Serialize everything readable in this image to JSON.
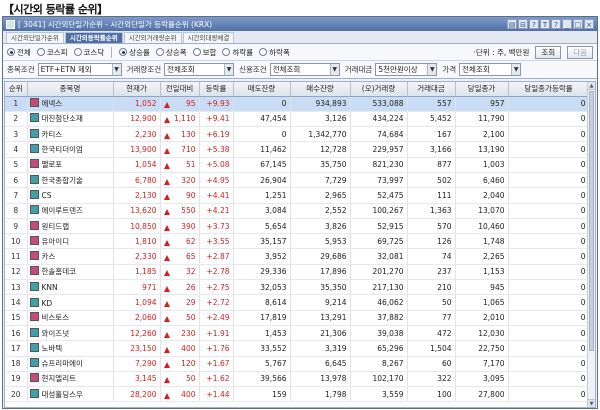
{
  "heading": "【시간외 등락률 순위】",
  "window": {
    "title": "[ 3041] 시간외단일가순위 - 시간외단일가 등락률순위 (KRX)",
    "controls": [
      "▤",
      "⊟",
      "?",
      "T",
      "?",
      "_",
      "□",
      "×"
    ]
  },
  "tabs": [
    "시간외단일가순위",
    "시간외등락률순위",
    "시간외거래량순위",
    "시간외대량체결"
  ],
  "active_tab": 1,
  "market_radios": [
    {
      "label": "전체",
      "on": true
    },
    {
      "label": "코스피",
      "on": false
    },
    {
      "label": "코스닥",
      "on": false
    }
  ],
  "change_radios": [
    {
      "label": "상승률",
      "on": true
    },
    {
      "label": "상승폭",
      "on": false
    },
    {
      "label": "보합",
      "on": false
    },
    {
      "label": "하락률",
      "on": false
    },
    {
      "label": "하락폭",
      "on": false
    }
  ],
  "unit_text": "·단위 : 주, 백만원",
  "buttons": {
    "query": "조회",
    "next": "다음"
  },
  "filters": [
    {
      "label": "종목조건",
      "value": "ETF+ETN 제외"
    },
    {
      "label": "거래량조건",
      "value": "전체조회"
    },
    {
      "label": "신용조건",
      "value": "전체조회"
    },
    {
      "label": "거래대금",
      "value": "5천만원이상"
    },
    {
      "label": "가격",
      "value": "전체조회"
    }
  ],
  "columns": [
    "순위",
    "종목명",
    "현재가",
    "전일대비",
    "등락률",
    "매도잔량",
    "매수잔량",
    "(오)거래량",
    "거래대금",
    "당일종가",
    "당일종가등락률"
  ],
  "rows": [
    {
      "rank": "1",
      "market": "P",
      "name": "에넥스",
      "price": "1,052",
      "change": "95",
      "rate": "+9.93",
      "ask": "0",
      "bid": "934,893",
      "volume": "533,088",
      "amount": "557",
      "close": "957",
      "close_rate": "0"
    },
    {
      "rank": "2",
      "market": "K",
      "name": "대진첨단소재",
      "price": "12,900",
      "change": "1,110",
      "rate": "+9.41",
      "ask": "47,454",
      "bid": "3,126",
      "volume": "434,224",
      "amount": "5,452",
      "close": "11,790",
      "close_rate": "0"
    },
    {
      "rank": "3",
      "market": "K",
      "name": "카티스",
      "price": "2,230",
      "change": "130",
      "rate": "+6.19",
      "ask": "0",
      "bid": "1,342,770",
      "volume": "74,684",
      "amount": "167",
      "close": "2,100",
      "close_rate": "0"
    },
    {
      "rank": "4",
      "market": "K",
      "name": "한국티더이엄",
      "price": "13,900",
      "change": "710",
      "rate": "+5.38",
      "ask": "11,462",
      "bid": "12,728",
      "volume": "229,957",
      "amount": "3,166",
      "close": "13,190",
      "close_rate": "0"
    },
    {
      "rank": "5",
      "market": "P",
      "name": "팰로포",
      "price": "1,054",
      "change": "51",
      "rate": "+5.08",
      "ask": "67,145",
      "bid": "35,750",
      "volume": "821,230",
      "amount": "877",
      "close": "1,003",
      "close_rate": "0"
    },
    {
      "rank": "6",
      "market": "K",
      "name": "한국종합기술",
      "price": "6,780",
      "change": "320",
      "rate": "+4.95",
      "ask": "26,904",
      "bid": "7,729",
      "volume": "73,997",
      "amount": "502",
      "close": "6,460",
      "close_rate": "0"
    },
    {
      "rank": "7",
      "market": "K",
      "name": "CS",
      "price": "2,130",
      "change": "90",
      "rate": "+4.41",
      "ask": "1,251",
      "bid": "2,965",
      "volume": "52,475",
      "amount": "111",
      "close": "2,040",
      "close_rate": "0"
    },
    {
      "rank": "8",
      "market": "K",
      "name": "에이루트덴즈",
      "price": "13,620",
      "change": "550",
      "rate": "+4.21",
      "ask": "3,084",
      "bid": "2,552",
      "volume": "100,267",
      "amount": "1,363",
      "close": "13,070",
      "close_rate": "0"
    },
    {
      "rank": "9",
      "market": "P",
      "name": "원티드랩",
      "price": "10,850",
      "change": "390",
      "rate": "+3.73",
      "ask": "5,654",
      "bid": "3,826",
      "volume": "52,915",
      "amount": "570",
      "close": "10,460",
      "close_rate": "0"
    },
    {
      "rank": "10",
      "market": "P",
      "name": "유아이디",
      "price": "1,810",
      "change": "62",
      "rate": "+3.55",
      "ask": "35,157",
      "bid": "5,953",
      "volume": "69,725",
      "amount": "126",
      "close": "1,748",
      "close_rate": "0"
    },
    {
      "rank": "11",
      "market": "P",
      "name": "카스",
      "price": "2,330",
      "change": "65",
      "rate": "+2.87",
      "ask": "3,952",
      "bid": "29,686",
      "volume": "32,081",
      "amount": "74",
      "close": "2,265",
      "close_rate": "0"
    },
    {
      "rank": "12",
      "market": "P",
      "name": "한솔홈데코",
      "price": "1,185",
      "change": "32",
      "rate": "+2.78",
      "ask": "29,336",
      "bid": "17,896",
      "volume": "201,270",
      "amount": "237",
      "close": "1,153",
      "close_rate": "0"
    },
    {
      "rank": "13",
      "market": "K",
      "name": "KNN",
      "price": "971",
      "change": "26",
      "rate": "+2.75",
      "ask": "32,053",
      "bid": "35,350",
      "volume": "217,130",
      "amount": "210",
      "close": "945",
      "close_rate": "0"
    },
    {
      "rank": "14",
      "market": "K",
      "name": "KD",
      "price": "1,094",
      "change": "29",
      "rate": "+2.72",
      "ask": "8,614",
      "bid": "9,214",
      "volume": "46,062",
      "amount": "50",
      "close": "1,065",
      "close_rate": "0"
    },
    {
      "rank": "15",
      "market": "P",
      "name": "비스토스",
      "price": "2,060",
      "change": "50",
      "rate": "+2.49",
      "ask": "17,819",
      "bid": "13,291",
      "volume": "37,882",
      "amount": "77",
      "close": "2,010",
      "close_rate": "0"
    },
    {
      "rank": "16",
      "market": "K",
      "name": "와이즈넛",
      "price": "12,260",
      "change": "230",
      "rate": "+1.91",
      "ask": "1,453",
      "bid": "21,306",
      "volume": "39,038",
      "amount": "472",
      "close": "12,030",
      "close_rate": "0"
    },
    {
      "rank": "17",
      "market": "K",
      "name": "노바텍",
      "price": "23,150",
      "change": "400",
      "rate": "+1.76",
      "ask": "33,552",
      "bid": "3,319",
      "volume": "65,296",
      "amount": "1,504",
      "close": "22,750",
      "close_rate": "0"
    },
    {
      "rank": "18",
      "market": "K",
      "name": "슈프리마에이",
      "price": "7,290",
      "change": "120",
      "rate": "+1.67",
      "ask": "5,767",
      "bid": "6,645",
      "volume": "8,267",
      "amount": "60",
      "close": "7,170",
      "close_rate": "0"
    },
    {
      "rank": "19",
      "market": "P",
      "name": "현지엘리트",
      "price": "3,145",
      "change": "50",
      "rate": "+1.62",
      "ask": "39,566",
      "bid": "13,978",
      "volume": "102,170",
      "amount": "322",
      "close": "3,095",
      "close_rate": "0"
    },
    {
      "rank": "20",
      "market": "K",
      "name": "대성홀딩스우",
      "price": "28,200",
      "change": "400",
      "rate": "+1.44",
      "ask": "159",
      "bid": "1,798",
      "volume": "3,559",
      "amount": "100",
      "close": "27,800",
      "close_rate": "0"
    }
  ],
  "colors": {
    "up": "#d61e1e",
    "selected_row": "#c9dcf6",
    "title_bar": "#4f6fa6",
    "kosdaq_marker": "#3fa0a8",
    "kospi_marker": "#c64a7a"
  }
}
